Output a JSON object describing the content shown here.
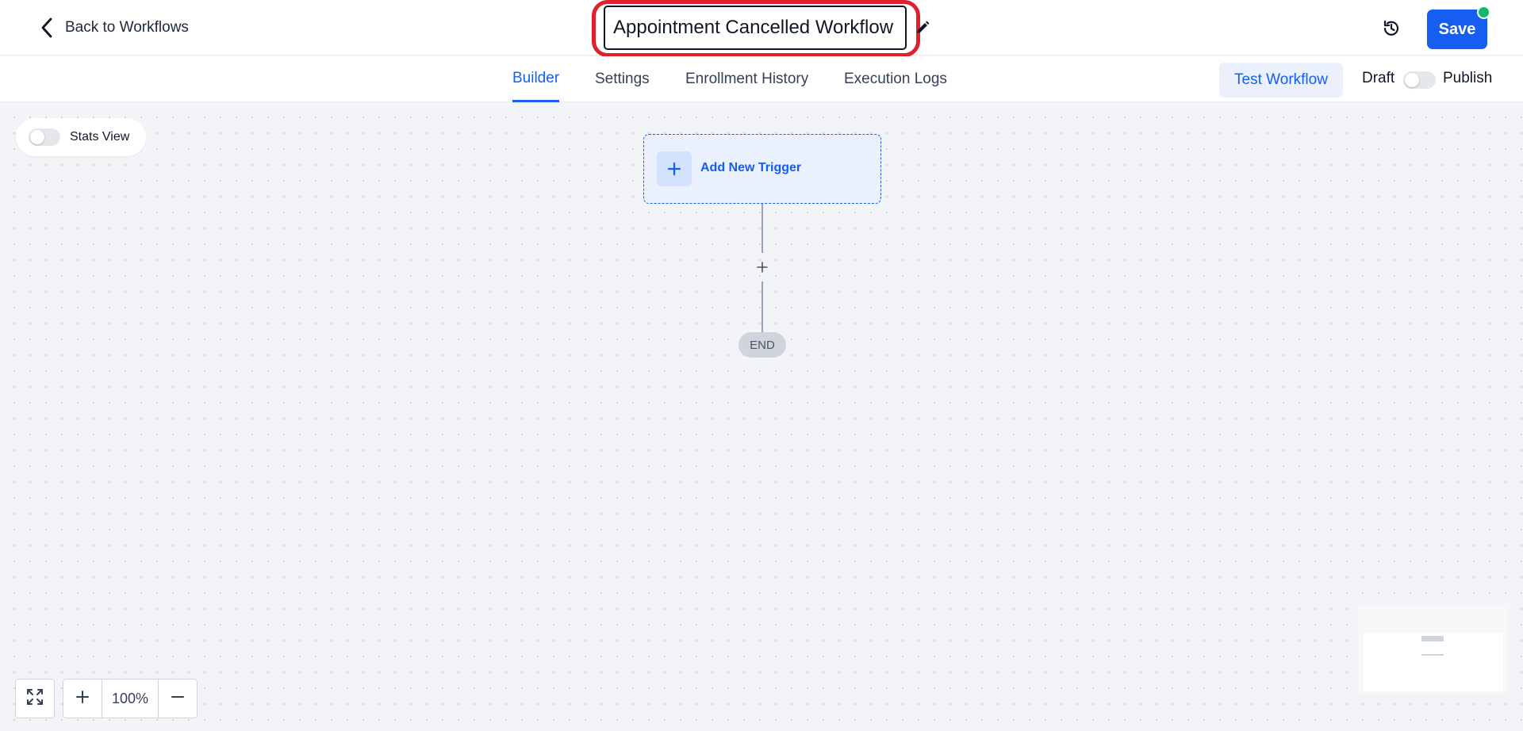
{
  "header": {
    "back_label": "Back to Workflows",
    "workflow_name": "Appointment Cancelled Workflow",
    "save_label": "Save"
  },
  "tabs": [
    {
      "label": "Builder",
      "active": true
    },
    {
      "label": "Settings",
      "active": false
    },
    {
      "label": "Enrollment History",
      "active": false
    },
    {
      "label": "Execution Logs",
      "active": false
    }
  ],
  "actions": {
    "test_label": "Test Workflow",
    "draft_label": "Draft",
    "publish_label": "Publish",
    "published": false
  },
  "canvas": {
    "stats_view_label": "Stats View",
    "stats_view_on": false,
    "trigger_label": "Add New Trigger",
    "end_label": "END"
  },
  "zoom": {
    "level": "100%"
  },
  "icons": {
    "back": "chevron-left-icon",
    "edit": "pencil-icon",
    "history": "clock-history-icon",
    "fit": "expand-icon",
    "zoom_in": "plus-icon",
    "zoom_out": "minus-icon"
  },
  "colors": {
    "accent": "#155eef",
    "highlight": "#e0202d",
    "status_dot": "#12b76a"
  }
}
